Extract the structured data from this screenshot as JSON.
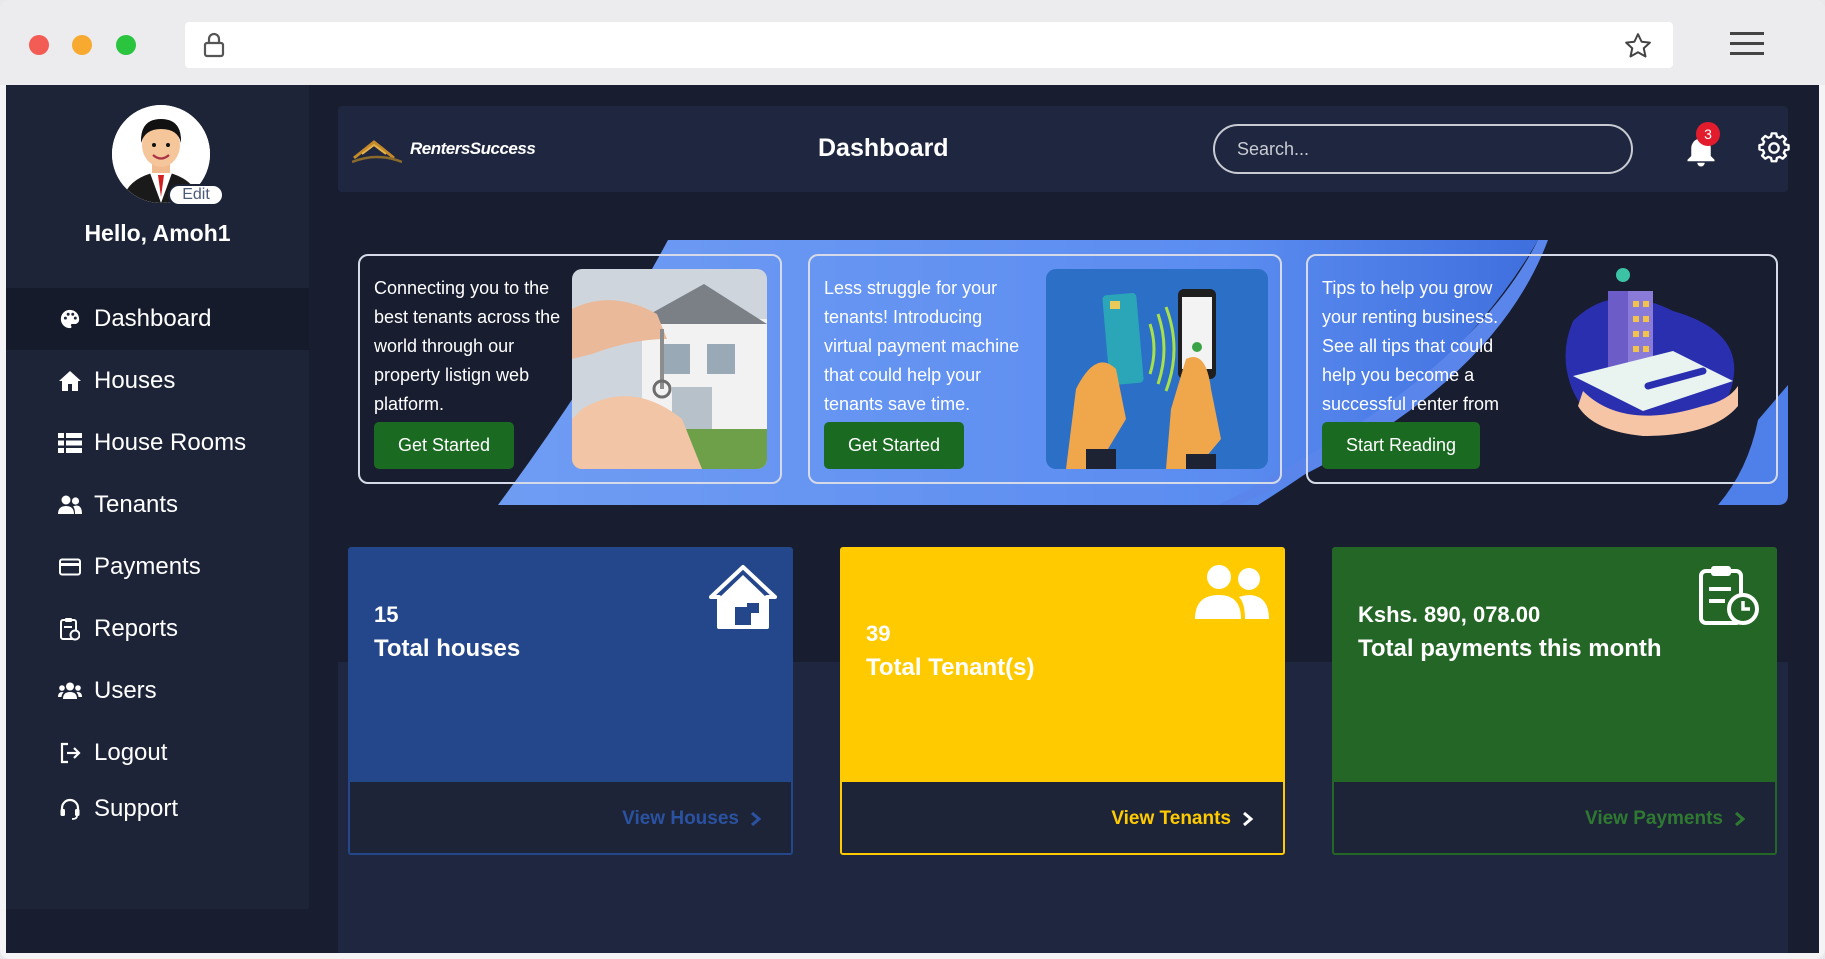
{
  "app": {
    "brand": "RentersSuccess",
    "page_title": "Dashboard"
  },
  "browser": {
    "icons": [
      "lock-icon",
      "star-icon",
      "menu-icon"
    ]
  },
  "sidebar": {
    "edit_label": "Edit",
    "greeting": "Hello, Amoh1",
    "items": [
      {
        "label": "Dashboard",
        "icon": "palette-icon",
        "active": true
      },
      {
        "label": "Houses",
        "icon": "home-icon"
      },
      {
        "label": "House Rooms",
        "icon": "list-icon"
      },
      {
        "label": "Tenants",
        "icon": "users-icon"
      },
      {
        "label": "Payments",
        "icon": "credit-card-icon"
      },
      {
        "label": "Reports",
        "icon": "report-icon"
      },
      {
        "label": "Users",
        "icon": "user-group-icon"
      },
      {
        "label": "Logout",
        "icon": "logout-icon"
      },
      {
        "label": "Support",
        "icon": "headset-icon"
      }
    ]
  },
  "header": {
    "search_placeholder": "Search...",
    "notification_count": "3"
  },
  "promos": [
    {
      "text": "Connecting you to the best tenants across the world through our property listign web platform.",
      "button": "Get Started"
    },
    {
      "text": "Less struggle for your tenants! Introducing virtual payment machine that could help your tenants save time.",
      "button": "Get Started"
    },
    {
      "text": "Tips to help you grow your renting business. See all tips that could help you become a successful renter from",
      "button": "Start Reading"
    }
  ],
  "stats": [
    {
      "value": "15",
      "label": "Total houses",
      "link": "View Houses",
      "color": "#24468a"
    },
    {
      "value": "39",
      "label": "Total Tenant(s)",
      "link": "View Tenants",
      "color": "#ffcb00"
    },
    {
      "value": "Kshs. 890, 078.00",
      "label": "Total payments this month",
      "link": "View Payments",
      "color": "#246625"
    }
  ],
  "colors": {
    "sidebar_bg": "#1d2438",
    "app_bg": "#181d30",
    "button_green": "#1b6a22",
    "banner_blue": "#5b8cf0",
    "badge_red": "#e21c2c"
  }
}
